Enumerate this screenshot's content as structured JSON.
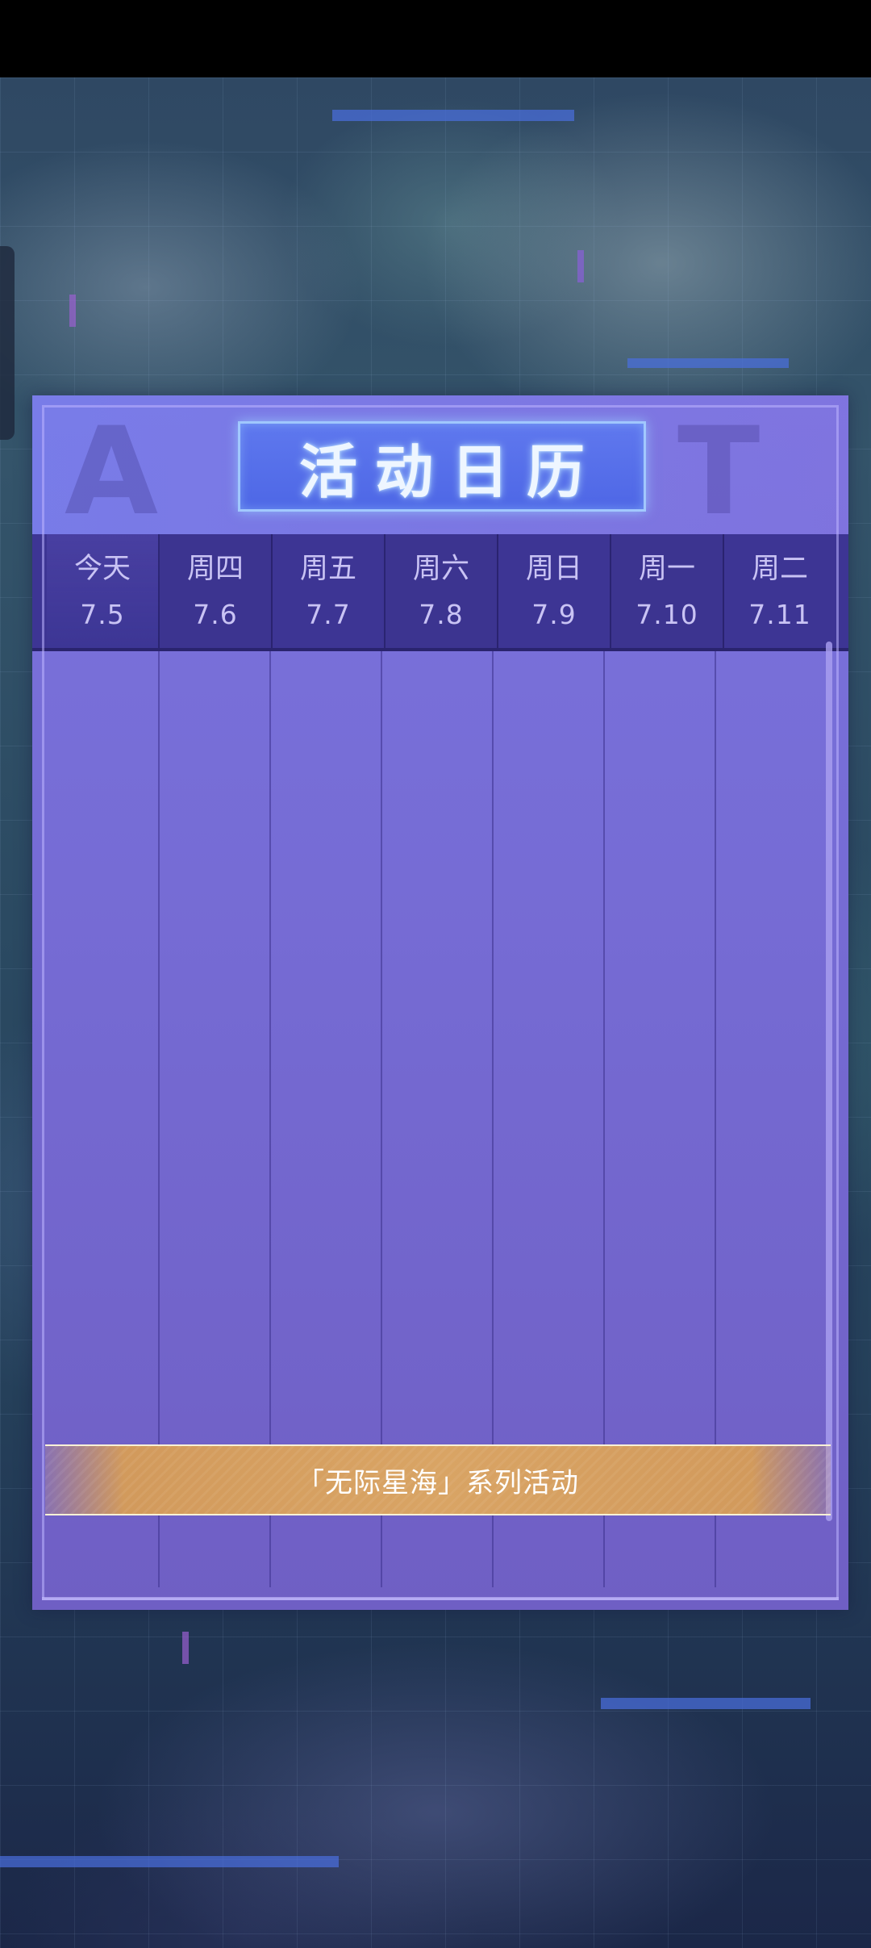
{
  "calendar": {
    "title": "活动日历",
    "days": [
      {
        "name": "今天",
        "date": "7.5"
      },
      {
        "name": "周四",
        "date": "7.6"
      },
      {
        "name": "周五",
        "date": "7.7"
      },
      {
        "name": "周六",
        "date": "7.8"
      },
      {
        "name": "周日",
        "date": "7.9"
      },
      {
        "name": "周一",
        "date": "7.10"
      },
      {
        "name": "周二",
        "date": "7.11"
      }
    ],
    "events": [
      {
        "label": "「无际星海」系列活动"
      }
    ]
  },
  "colors": {
    "panel": "#766cd5",
    "header_row": "#3d3594",
    "event_bar": "#d9a464",
    "title_glow": "#bfe0ff"
  }
}
